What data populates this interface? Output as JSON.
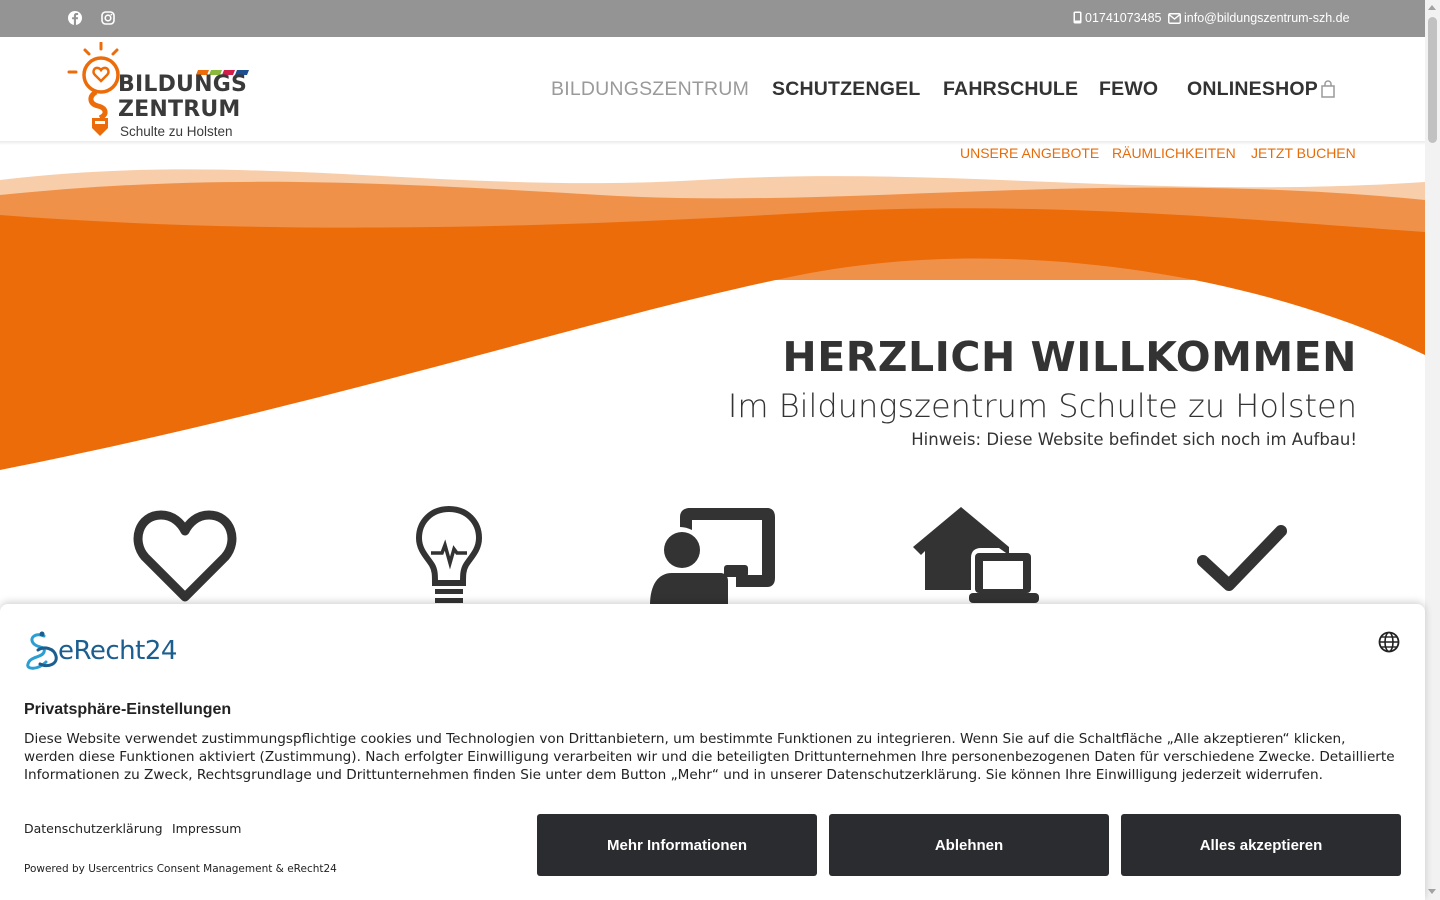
{
  "topbar": {
    "icons": [
      "facebook-icon",
      "instagram-icon"
    ],
    "phone": "01741073485",
    "email": "info@bildungszentrum-szh.de"
  },
  "logo": {
    "line1": "BILDUNGS",
    "line2": "ZENTRUM",
    "line3": "Schulte zu Holsten"
  },
  "nav": {
    "items": [
      {
        "label": "BILDUNGSZENTRUM"
      },
      {
        "label": "SCHUTZENGEL"
      },
      {
        "label": "FAHRSCHULE"
      },
      {
        "label": "FEWO"
      },
      {
        "label": "ONLINESHOP"
      }
    ],
    "active_index": 0,
    "sub_items": [
      {
        "label": "UNSERE ANGEBOTE"
      },
      {
        "label": "RÄUMLICHKEITEN"
      },
      {
        "label": "JETZT BUCHEN"
      }
    ]
  },
  "hero": {
    "title": "HERZLICH WILLKOMMEN",
    "subtitle": "Im Bildungszentrum Schulte zu Holsten",
    "note": "Hinweis: Diese Website befindet sich noch im Aufbau!"
  },
  "features": {
    "icons": [
      "heart-icon",
      "lightbulb-icon",
      "teacher-board-icon",
      "home-laptop-icon",
      "checkmark-icon"
    ]
  },
  "consent": {
    "brand": "eRecht24",
    "title": "Privatsphäre-Einstellungen",
    "text": "Diese Website verwendet zustimmungspflichtige cookies und Technologien von Drittanbietern, um bestimmte Funktionen zu integrieren. Wenn Sie auf die Schaltfläche „Alle akzeptieren“ klicken, werden diese Funktionen aktiviert (Zustimmung). Nach erfolgter Einwilligung verarbeiten wir und die beteiligten Drittunternehmen Ihre personenbezogenen Daten für verschiedene Zwecke. Detaillierte Informationen zu Zweck, Rechtsgrundlage und Drittunternehmen finden Sie unter dem Button „Mehr“ und in unserer Datenschutzerklärung. Sie können Ihre Einwilligung jederzeit widerrufen.",
    "link_privacy": "Datenschutzerklärung",
    "link_imprint": "Impressum",
    "powered": "Powered by Usercentrics Consent Management & eRecht24",
    "btn_more": "Mehr Informationen",
    "btn_decline": "Ablehnen",
    "btn_accept": "Alles akzeptieren"
  },
  "colors": {
    "accent": "#ec6c0a",
    "topbar": "#949494",
    "button": "#2a2c30",
    "brand_blue": "#1b5e8f"
  }
}
